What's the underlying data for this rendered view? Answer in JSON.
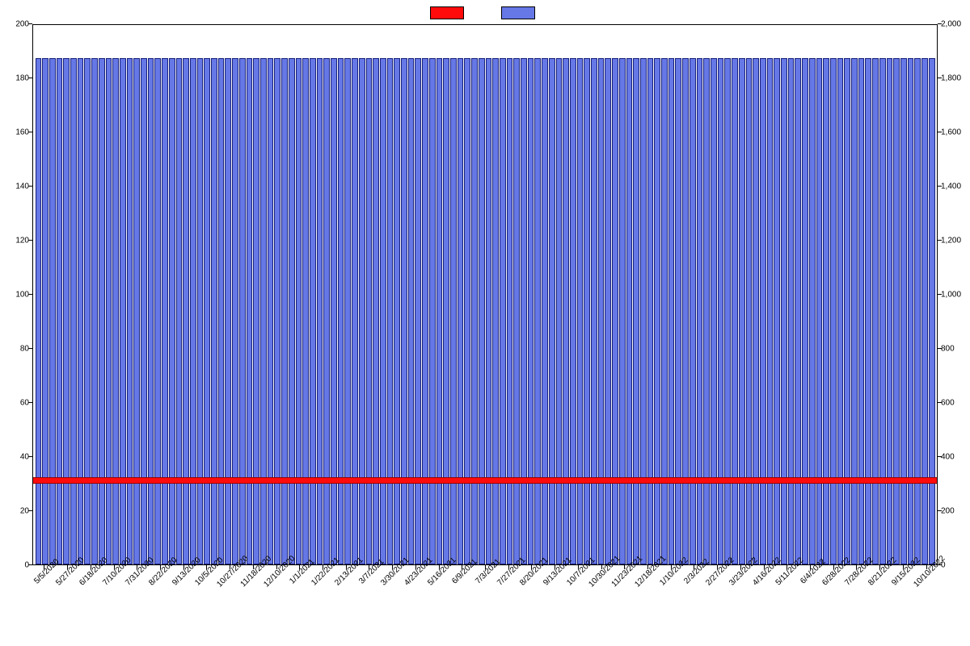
{
  "chart_data": {
    "type": "bar",
    "title": "",
    "xlabel": "",
    "y_left": {
      "label": "",
      "lim": [
        0,
        200
      ],
      "ticks": [
        0,
        20,
        40,
        60,
        80,
        100,
        120,
        140,
        160,
        180,
        200
      ]
    },
    "y_right": {
      "label": "",
      "lim": [
        0,
        2000
      ],
      "ticks": [
        0,
        200,
        400,
        600,
        800,
        1000,
        1200,
        1400,
        1600,
        1800,
        2000
      ],
      "tick_labels": [
        "0",
        "200",
        "400",
        "600",
        "800",
        "1,000",
        "1,200",
        "1,400",
        "1,600",
        "1,800",
        "2,000"
      ]
    },
    "legend": [
      {
        "name": "",
        "color": "#ff0b0b"
      },
      {
        "name": "",
        "color": "#6677e6"
      }
    ],
    "x_tick_labels": [
      "5/5/2020",
      "5/27/2020",
      "6/18/2020",
      "7/10/2020",
      "7/31/2020",
      "8/22/2020",
      "9/13/2020",
      "10/5/2020",
      "10/27/2020",
      "11/18/2020",
      "12/10/2020",
      "1/1/2021",
      "1/22/2021",
      "2/13/2021",
      "3/7/2021",
      "3/30/2021",
      "4/23/2021",
      "5/16/2021",
      "6/9/2021",
      "7/3/2021",
      "7/27/2021",
      "8/20/2021",
      "9/13/2021",
      "10/7/2021",
      "10/30/2021",
      "11/23/2021",
      "12/18/2021",
      "1/10/2022",
      "2/3/2022",
      "2/27/2022",
      "3/23/2022",
      "4/16/2022",
      "5/11/2022",
      "6/4/2022",
      "6/28/2022",
      "7/28/2022",
      "8/21/2022",
      "9/15/2022",
      "10/10/2022"
    ],
    "bar_count": 128,
    "series": [
      {
        "name": "",
        "axis": "right",
        "color": "#6677e6",
        "all_values_approx": 1870
      },
      {
        "name": "",
        "axis": "left",
        "color": "#ff0b0b",
        "all_values_approx": 30
      }
    ]
  }
}
